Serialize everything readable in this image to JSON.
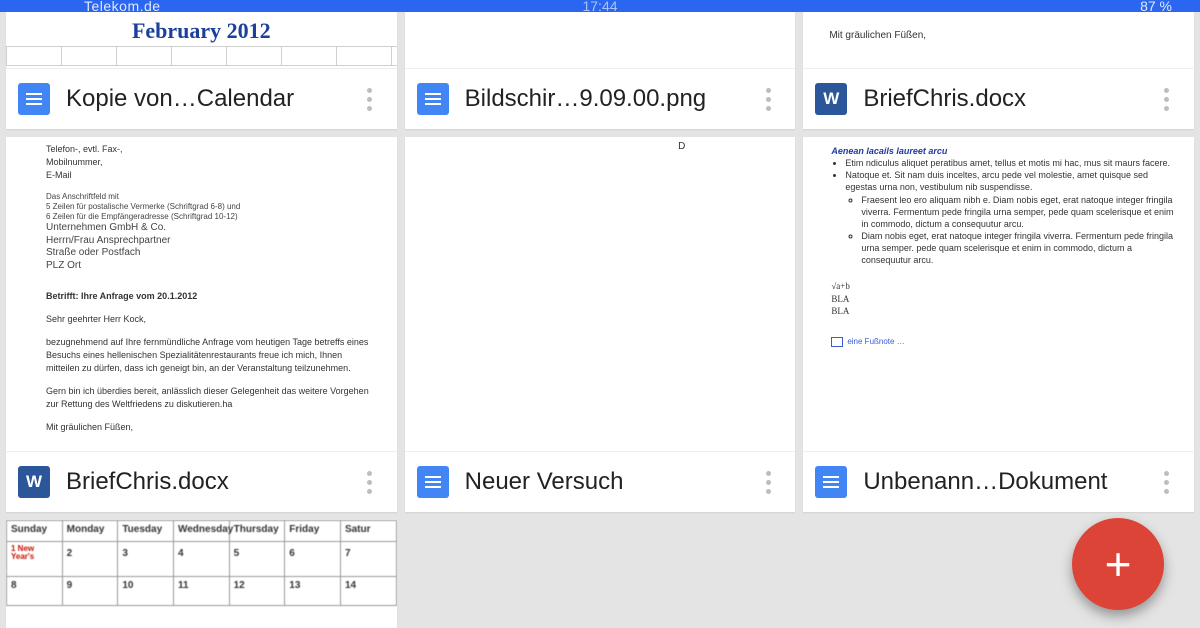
{
  "statusbar": {
    "carrier": "Telekom.de",
    "time": "17:44",
    "battery": "87 %"
  },
  "files": [
    {
      "title": "Kopie von…Calendar",
      "type": "docs"
    },
    {
      "title": "Bildschir…9.09.00.png",
      "type": "docs"
    },
    {
      "title": "BriefChris.docx",
      "type": "word"
    },
    {
      "title": "BriefChris.docx",
      "type": "word"
    },
    {
      "title": "Neuer Versuch",
      "type": "docs"
    },
    {
      "title": "Unbenann…Dokument",
      "type": "docs"
    }
  ],
  "previews": {
    "calendar_title": "February 2012",
    "greeting": "Mit gräulichen Füßen,",
    "letter": {
      "header_lines": [
        "Telefon-, evtl. Fax-,",
        "Mobilnummer,",
        "E-Mail"
      ],
      "address_small_1": "Das Anschriftfeld mit",
      "address_small_2": "5 Zeilen für postalische Vermerke (Schriftgrad 6-8) und",
      "address_small_3": "6 Zeilen für die Empfängeradresse (Schriftgrad 10-12)",
      "address_1": "Unternehmen GmbH & Co.",
      "address_2": "Herrn/Frau Ansprechpartner",
      "address_3": "Straße oder Postfach",
      "address_4": "PLZ Ort",
      "subject": "Betrifft: Ihre Anfrage vom 20.1.2012",
      "salutation": "Sehr geehrter Herr Kock,",
      "body_1": "bezugnehmend auf Ihre fernmündliche Anfrage vom heutigen Tage betreffs eines Besuchs eines hellenischen Spezialitätenrestaurants freue ich mich, Ihnen mitteilen zu dürfen, dass ich geneigt bin, an der Veranstaltung teilzunehmen.",
      "body_2": "Gern bin ich überdies bereit, anlässlich dieser Gelegenheit das weitere Vorgehen zur Rettung des Weltfriedens zu diskutieren.ha",
      "closing": "Mit gräulichen Füßen,"
    },
    "word_doc": {
      "heading": "Aenean lacails laureet arcu",
      "p1": "Etim ndiculus aliquet peratibus amet, tellus et motis mi hac, mus sit maurs facere.",
      "p2": "Natoque et. Sit nam duis inceltes, arcu pede vel molestie, amet quisque sed egestas urna non, vestibulum nib suspendisse.",
      "c1": "Fraesent leo ero aliquam nibh e. Diam nobis eget, erat natoque integer fringila viverra. Fermentum pede fringila urna semper, pede quam scelerisque et enim in commodo, dictum a consequutur arcu.",
      "c2": "Diam nobis eget, erat natoque integer fringila viverra. Fermentum pede fringila urna semper. pede quam scelerisque et enim in commodo, dictum a consequutur arcu.",
      "math1": "√a+b",
      "math2": "BLA",
      "math3": "BLA",
      "footnote": "eine Fußnote …"
    },
    "blank_doc_char": "D",
    "calendar_table": {
      "days": [
        "Sunday",
        "Monday",
        "Tuesday",
        "Wednesday",
        "Thursday",
        "Friday",
        "Satur"
      ],
      "row1_label": "1 New Year's",
      "row1": [
        "2",
        "3",
        "4",
        "5",
        "6",
        "7"
      ],
      "row2": [
        "8",
        "9",
        "10",
        "11",
        "12",
        "13",
        "14"
      ]
    }
  },
  "fab_label": "+"
}
